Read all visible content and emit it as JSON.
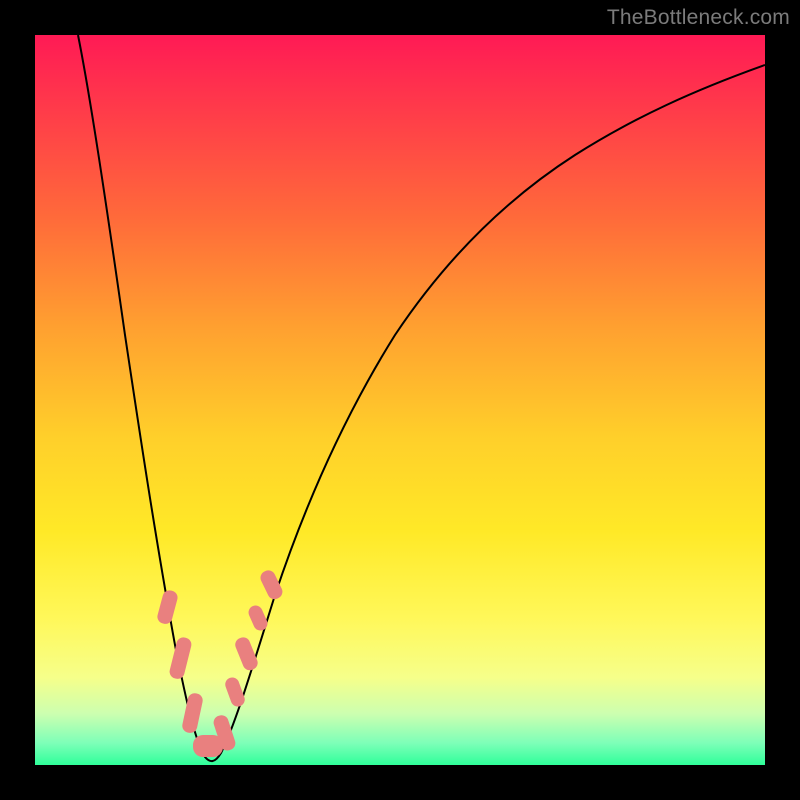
{
  "watermark": "TheBottleneck.com",
  "colors": {
    "frame": "#000000",
    "curve": "#000000",
    "blob": "#e9807f",
    "gradient_top": "#ff1a55",
    "gradient_bottom": "#2fff9a"
  },
  "chart_data": {
    "type": "line",
    "title": "",
    "xlabel": "",
    "ylabel": "",
    "xlim": [
      0,
      100
    ],
    "ylim": [
      0,
      100
    ],
    "y_orientation": "top_is_high_bottleneck",
    "note": "Axes unlabeled in source image; x/y are normalized 0–100. Curve shows bottleneck % vs. a parameter, with a sharp minimum near x≈23. Values estimated from pixel positions.",
    "series": [
      {
        "name": "bottleneck-curve",
        "x": [
          6,
          8,
          10,
          12,
          14,
          16,
          18,
          20,
          21,
          22,
          23,
          24,
          25,
          27,
          30,
          35,
          40,
          45,
          50,
          55,
          60,
          65,
          70,
          75,
          80,
          85,
          90,
          95,
          100
        ],
        "y": [
          100,
          90,
          79,
          68,
          56,
          44,
          32,
          18,
          11,
          5,
          1,
          4,
          9,
          18,
          29,
          42,
          52,
          59,
          65,
          70,
          74,
          77,
          80,
          82.5,
          84.5,
          86,
          87.5,
          88.7,
          90
        ]
      }
    ],
    "highlight_segments": {
      "description": "Salmon capsule markers overlaid on the curve near the trough",
      "x_ranges": [
        [
          17.8,
          19.0
        ],
        [
          19.8,
          21.5
        ],
        [
          21.8,
          23.8
        ],
        [
          23.8,
          25.2
        ],
        [
          25.4,
          26.4
        ],
        [
          26.9,
          28.2
        ],
        [
          28.6,
          29.6
        ],
        [
          30.4,
          31.6
        ]
      ]
    }
  }
}
